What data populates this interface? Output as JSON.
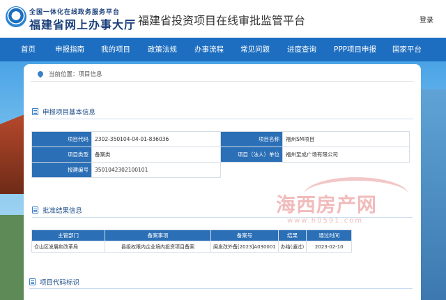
{
  "header": {
    "logo_line1": "全国一体化在线政务服务平台",
    "logo_line2": "福建省网上办事大厅",
    "site_title": "福建省投资项目在线审批监管平台",
    "login_label": "登录"
  },
  "nav": {
    "items": [
      "首页",
      "申报指南",
      "我的项目",
      "政策法规",
      "办事流程",
      "常见问题",
      "进度查询",
      "PPP项目申报",
      "国家平台"
    ]
  },
  "breadcrumb": {
    "prefix": "当前位置：",
    "current": "项目信息"
  },
  "basic_info": {
    "section_title": "申报项目基本信息",
    "rows": [
      {
        "label1": "项目代码",
        "value1": "2302-350104-04-01-836036",
        "label2": "项目名称",
        "value2": "福州SM项目"
      },
      {
        "label1": "项目类型",
        "value1": "备案类",
        "label2": "项目（法人）单位",
        "value2": "福州至成广场有限公司"
      },
      {
        "label1": "报建编号",
        "value1": "3501042302100101"
      }
    ]
  },
  "approval": {
    "section_title": "批准结果信息",
    "columns": [
      "主管部门",
      "备案事项",
      "备案号",
      "结果",
      "通过时间"
    ],
    "rows": [
      [
        "仓山区发展和改革局",
        "县级权限内企业境内投资项目备案",
        "闽发改外备[2023]A030001",
        "办结(通过)",
        "2023-02-10"
      ]
    ]
  },
  "code_section": {
    "section_title": "项目代码标识"
  },
  "watermark": {
    "text": "海西房产网",
    "url": "www.h0591.com"
  },
  "colors": {
    "nav_bg": "#1d6ec0",
    "table_header": "#2b6fb6",
    "title_text": "#1e4f8a"
  }
}
